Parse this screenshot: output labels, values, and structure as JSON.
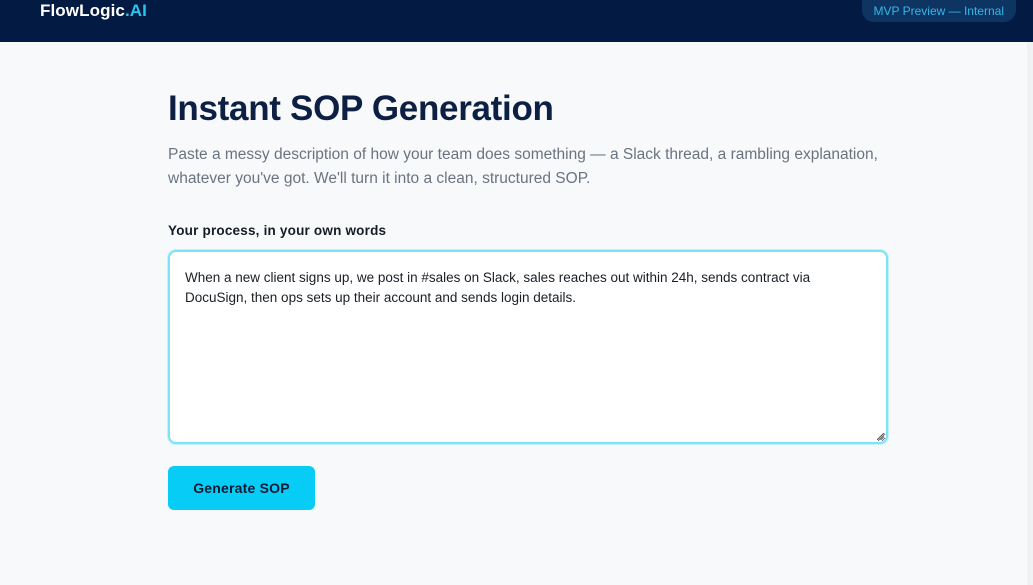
{
  "header": {
    "brand_main": "FlowLogic",
    "brand_accent": ".AI",
    "badge": "MVP Preview — Internal"
  },
  "main": {
    "title": "Instant SOP Generation",
    "subtitle": "Paste a messy description of how your team does something — a Slack thread, a rambling explanation, whatever you've got. We'll turn it into a clean, structured SOP.",
    "field_label": "Your process, in your own words",
    "textarea_value": "When a new client signs up, we post in #sales on Slack, sales reaches out within 24h, sends contract via DocuSign, then ops sets up their account and sends login details.",
    "button_label": "Generate SOP"
  },
  "colors": {
    "header_bg": "#031a43",
    "accent": "#07cdf6",
    "page_bg": "#f7f9fb",
    "title": "#0d1f43"
  }
}
